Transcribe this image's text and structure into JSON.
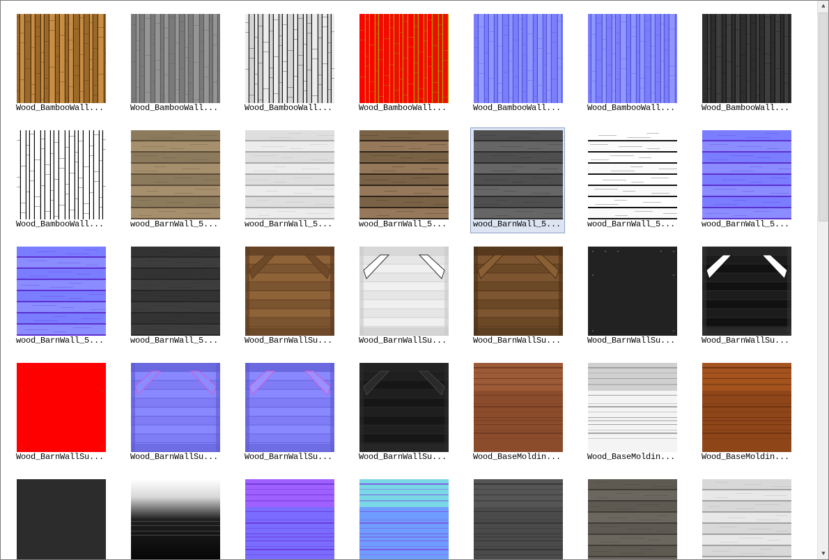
{
  "items": [
    {
      "label": "Wood_BambooWall...",
      "tex": "vbamboo",
      "c1": "#9b6a2a",
      "c2": "#c98e44",
      "line": "#4b2e0e"
    },
    {
      "label": "Wood_BambooWall...",
      "tex": "vbamboo",
      "c1": "#7a7a7a",
      "c2": "#959595",
      "line": "#5a5a5a"
    },
    {
      "label": "Wood_BambooWall...",
      "tex": "vbamboo",
      "c1": "#ececec",
      "c2": "#d4d4d4",
      "line": "#111111"
    },
    {
      "label": "Wood_BambooWall...",
      "tex": "vbamboo",
      "c1": "#ff0000",
      "c2": "#f20c00",
      "line": "#96b400"
    },
    {
      "label": "Wood_BambooWall...",
      "tex": "vbamboo",
      "c1": "#7b7dfb",
      "c2": "#9096ff",
      "line": "#4f55d8"
    },
    {
      "label": "Wood_BambooWall...",
      "tex": "vbamboo",
      "c1": "#7b7dfb",
      "c2": "#9096ff",
      "line": "#4f55d8"
    },
    {
      "label": "Wood_BambooWall...",
      "tex": "vbamboo",
      "c1": "#2e2e2e",
      "c2": "#3e3e3e",
      "line": "#151515"
    },
    {
      "label": "Wood_BambooWall...",
      "tex": "vbamboo",
      "c1": "#ffffff",
      "c2": "#ffffff",
      "line": "#000000"
    },
    {
      "label": "wood_BarnWall_5...",
      "tex": "hplank",
      "c1": "#8c7a5d",
      "c2": "#a58f6d",
      "line": "#5b4b36"
    },
    {
      "label": "wood_BarnWall_5...",
      "tex": "hplank",
      "c1": "#dedede",
      "c2": "#ececec",
      "line": "#a8a8a8"
    },
    {
      "label": "wood_BarnWall_5...",
      "tex": "hplank",
      "c1": "#7a6246",
      "c2": "#95795a",
      "line": "#2f2418"
    },
    {
      "label": "wood_BarnWall_5...",
      "tex": "hplank",
      "c1": "#4f4f4f",
      "c2": "#666666",
      "line": "#2b2b2b"
    },
    {
      "label": "wood_BarnWall_5...",
      "tex": "hplank",
      "c1": "#ffffff",
      "c2": "#fafafa",
      "line": "#111111"
    },
    {
      "label": "wood_BarnWall_5...",
      "tex": "hplank",
      "c1": "#7a7dff",
      "c2": "#8a8cff",
      "line": "#5b2fd0"
    },
    {
      "label": "wood_BarnWall_5...",
      "tex": "hplank",
      "c1": "#7a7dff",
      "c2": "#8a8cff",
      "line": "#5b2fd0"
    },
    {
      "label": "wood_BarnWall_5...",
      "tex": "hplank",
      "c1": "#333333",
      "c2": "#3d3d3d",
      "line": "#262626"
    },
    {
      "label": "Wood_BarnWallSu...",
      "tex": "frame",
      "c1": "#7b5430",
      "c2": "#8e6338",
      "line": "#5a3b1f",
      "brace": "#6e4a28"
    },
    {
      "label": "Wood_BarnWallSu...",
      "tex": "frame",
      "c1": "#f0f0f0",
      "c2": "#e6e6e6",
      "line": "#c8c8c8",
      "brace": "#ffffff",
      "bstroke": "#2a2a2a"
    },
    {
      "label": "Wood_BarnWallSu...",
      "tex": "frame",
      "c1": "#6b4826",
      "c2": "#7d5530",
      "line": "#4a3018",
      "brace": "#8a5f34"
    },
    {
      "label": "Wood_BarnWallSu...",
      "tex": "dots",
      "c1": "#222222",
      "c2": "#262626",
      "line": "#555555"
    },
    {
      "label": "Wood_BarnWallSu...",
      "tex": "frame",
      "c1": "#111111",
      "c2": "#1c1c1c",
      "line": "#333333",
      "brace": "#ffffff",
      "bstroke": "#111111"
    },
    {
      "label": "Wood_BarnWallSu...",
      "tex": "dots",
      "c1": "#ff0000",
      "c2": "#ff0000",
      "line": "#c03000"
    },
    {
      "label": "Wood_BarnWallSu...",
      "tex": "frame",
      "c1": "#7f7cf5",
      "c2": "#8a88ff",
      "line": "#5b5bd0",
      "brace": "#8a8cff",
      "bstroke": "#d05ad0"
    },
    {
      "label": "Wood_BarnWallSu...",
      "tex": "frame",
      "c1": "#7f7cf5",
      "c2": "#8a88ff",
      "line": "#5b5bd0",
      "brace": "#9a90ff",
      "bstroke": "#d05ad0"
    },
    {
      "label": "Wood_BarnWallSu...",
      "tex": "frame",
      "c1": "#161616",
      "c2": "#1f1f1f",
      "line": "#2c2c2c",
      "brace": "#2a2a2a",
      "bstroke": "#444444"
    },
    {
      "label": "Wood_BaseMoldin...",
      "tex": "hband",
      "c1": "#8b4c2c",
      "c2": "#9d5a36",
      "line": "#6e3920"
    },
    {
      "label": "Wood_BaseMoldin...",
      "tex": "hband",
      "c1": "#f4f4f4",
      "c2": "#d0d0d0",
      "line": "#9a9a9a"
    },
    {
      "label": "Wood_BaseMoldin...",
      "tex": "hband",
      "c1": "#8e4518",
      "c2": "#a4531e",
      "line": "#6a3210"
    },
    {
      "label": "",
      "tex": "flat",
      "c1": "#2a2a2a",
      "c2": "#2f2f2f",
      "line": "#252525"
    },
    {
      "label": "",
      "tex": "gradient",
      "c1": "#ffffff",
      "c2": "#000000",
      "line": "#444444"
    },
    {
      "label": "",
      "tex": "hband",
      "c1": "#7a6cff",
      "c2": "#a060ff",
      "line": "#6a3ad8"
    },
    {
      "label": "",
      "tex": "hband",
      "c1": "#6f9cff",
      "c2": "#7ad8e6",
      "line": "#7a55e0"
    },
    {
      "label": "",
      "tex": "hband",
      "c1": "#4a4a4a",
      "c2": "#555555",
      "line": "#333333"
    },
    {
      "label": "",
      "tex": "hplank",
      "c1": "#5e5a52",
      "c2": "#6c675e",
      "line": "#3f3c36"
    },
    {
      "label": "",
      "tex": "hplank",
      "c1": "#d8d8d8",
      "c2": "#e8e8e8",
      "line": "#a0a0a0"
    }
  ],
  "selected_index": 11,
  "scroll_up_glyph": "▲",
  "scroll_down_glyph": "▼"
}
